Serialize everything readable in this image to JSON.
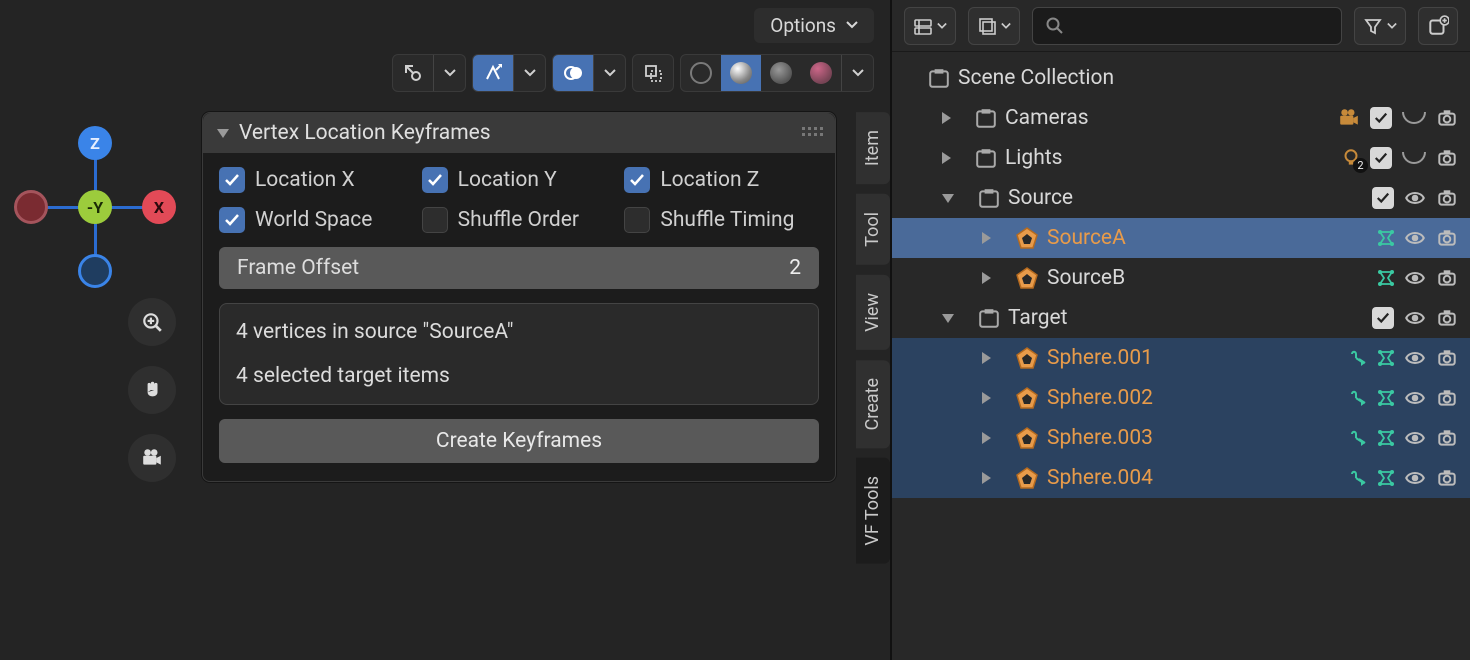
{
  "header": {
    "options_label": "Options"
  },
  "panel": {
    "title": "Vertex Location Keyframes",
    "checks": {
      "loc_x": "Location X",
      "loc_y": "Location Y",
      "loc_z": "Location Z",
      "world_space": "World Space",
      "shuffle_order": "Shuffle Order",
      "shuffle_timing": "Shuffle Timing"
    },
    "frame_offset_label": "Frame Offset",
    "frame_offset_value": "2",
    "info_line1": "4 vertices in source \"SourceA\"",
    "info_line2": "4 selected target items",
    "action_label": "Create Keyframes"
  },
  "nav": {
    "z": "Z",
    "x": "X",
    "y": "-Y"
  },
  "vtabs": [
    "Item",
    "Tool",
    "View",
    "Create",
    "VF Tools"
  ],
  "outliner": {
    "root": "Scene Collection",
    "items": [
      {
        "name": "Cameras",
        "kind": "collection",
        "icon": "camera"
      },
      {
        "name": "Lights",
        "kind": "collection",
        "icon": "light",
        "badge": "2"
      },
      {
        "name": "Source",
        "kind": "collection",
        "expanded": true,
        "children": [
          {
            "name": "SourceA",
            "kind": "mesh",
            "selected": "active",
            "modifier": true
          },
          {
            "name": "SourceB",
            "kind": "mesh",
            "modifier": true
          }
        ]
      },
      {
        "name": "Target",
        "kind": "collection",
        "expanded": true,
        "children": [
          {
            "name": "Sphere.001",
            "kind": "mesh",
            "selected": "sel",
            "constraint": true,
            "modifier": true
          },
          {
            "name": "Sphere.002",
            "kind": "mesh",
            "selected": "sel",
            "constraint": true,
            "modifier": true
          },
          {
            "name": "Sphere.003",
            "kind": "mesh",
            "selected": "sel",
            "constraint": true,
            "modifier": true
          },
          {
            "name": "Sphere.004",
            "kind": "mesh",
            "selected": "sel",
            "constraint": true,
            "modifier": true
          }
        ]
      }
    ]
  }
}
